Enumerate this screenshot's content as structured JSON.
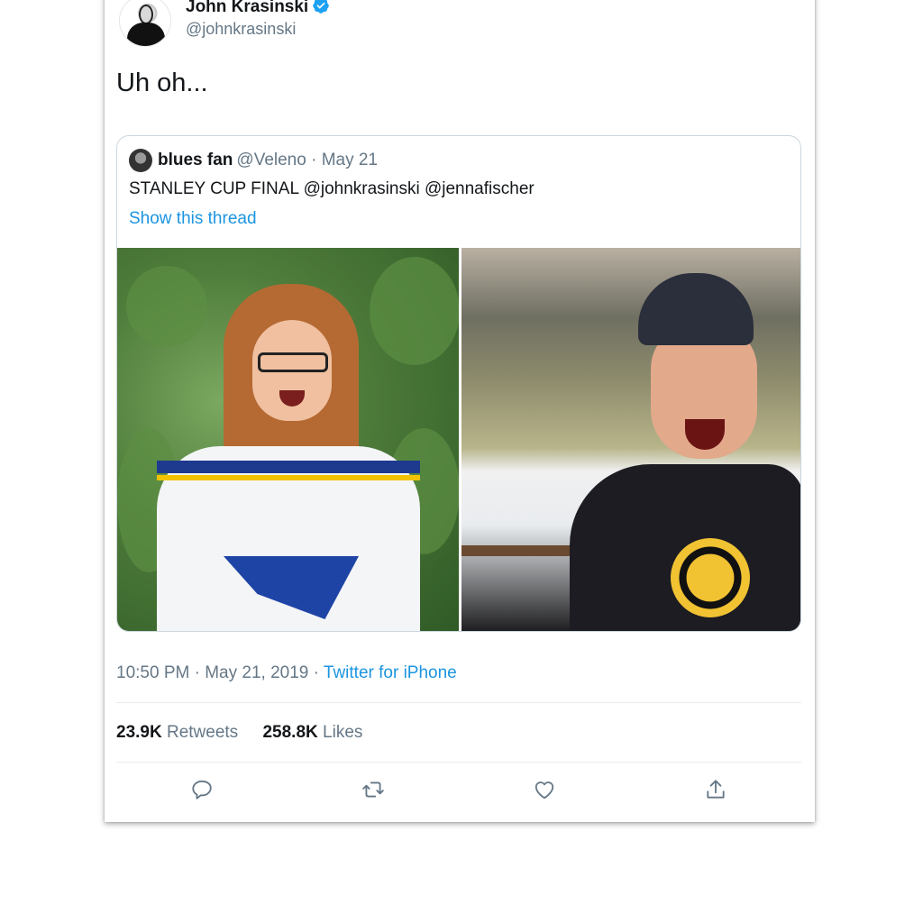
{
  "tweet": {
    "author_name": "John Krasinski",
    "author_handle": "@johnkrasinski",
    "text": "Uh oh...",
    "quoted": {
      "name": "blues fan",
      "handle_date": "@Veleno · May 21",
      "text": "STANLEY CUP FINAL @johnkrasinski @jennafischer",
      "thread_link": "Show this thread"
    },
    "timestamp": "10:50 PM · May 21, 2019 · ",
    "source": "Twitter for iPhone",
    "retweets_count": "23.9K",
    "retweets_label": "Retweets",
    "likes_count": "258.8K",
    "likes_label": "Likes"
  },
  "icons": {
    "verified": "verified-badge-icon",
    "more": "chevron-down-icon",
    "reply": "reply-icon",
    "retweet": "retweet-icon",
    "like": "heart-icon",
    "share": "share-icon"
  },
  "colors": {
    "accent": "#1b95e0",
    "verified": "#1da1f2",
    "secondary_text": "#657786",
    "primary_text": "#14171a"
  }
}
